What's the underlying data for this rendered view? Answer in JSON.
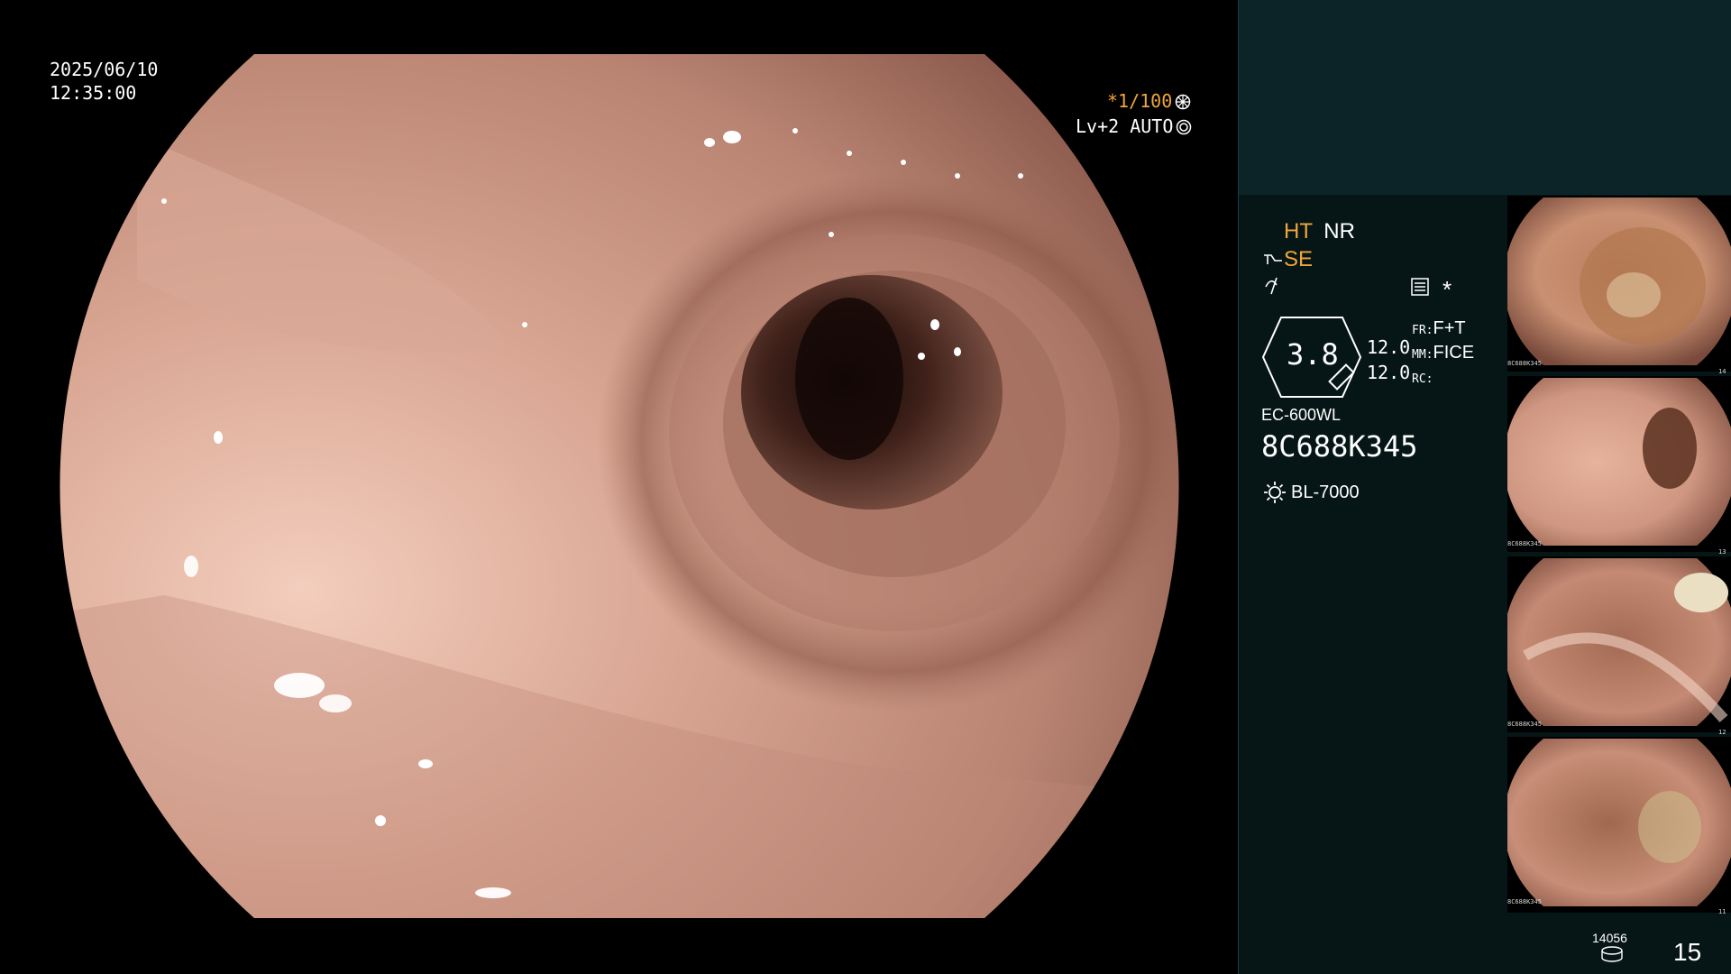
{
  "datetime": {
    "date": "2025/06/10",
    "time": "12:35:00"
  },
  "overlay": {
    "shutter": "*1/100",
    "shutter_icon": "aperture-icon",
    "level": "Lv+2 AUTO",
    "level_icon": "iris-icon"
  },
  "panel": {
    "mode_ht": "HT",
    "mode_nr": "NR",
    "se_label": "SE",
    "scope_icon": "scope-tip-icon",
    "wave_icon": "wave-icon",
    "menu_icon": "list-box-icon",
    "star": "*",
    "zoom_value": "3.8",
    "val_top": "12.0",
    "val_bottom": "12.0",
    "fr_label": "FR:",
    "fr_value": "F+T",
    "mm_label": "MM:",
    "mm_value": "FICE",
    "rc_label": "RC:",
    "rc_value": "",
    "scope_model": "EC-600WL",
    "scope_serial": "8C688K345",
    "light_icon": "sun-icon",
    "light_source": "BL-7000",
    "counter_small": "14056",
    "counter_icon": "disk-icon",
    "image_count": "15"
  },
  "thumbnails": [
    {
      "index": "14",
      "serial": "8C688K345"
    },
    {
      "index": "13",
      "serial": "8C688K345"
    },
    {
      "index": "12",
      "serial": "8C688K345"
    },
    {
      "index": "11",
      "serial": "8C688K345"
    }
  ],
  "colors": {
    "accent_orange": "#f0a63a",
    "panel_top": "#0c2427",
    "panel_body": "#061616",
    "tissue": "#c48a78"
  }
}
